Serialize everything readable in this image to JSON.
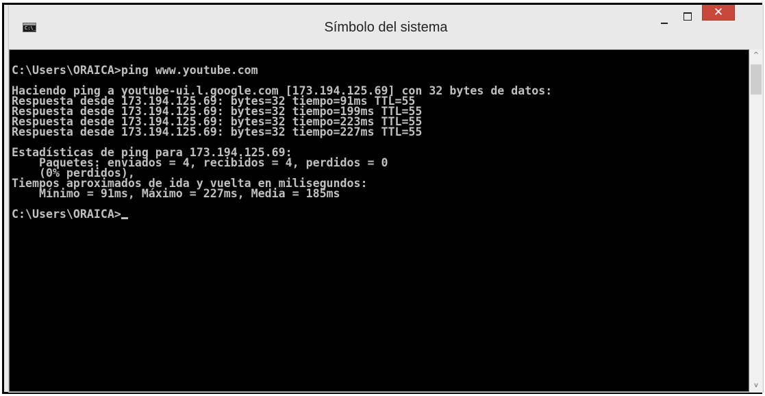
{
  "window": {
    "title": "Símbolo del sistema",
    "icon": "cmd-icon",
    "icon_text": "C:\\_",
    "controls": {
      "minimize_icon": "minimize-icon",
      "maximize_icon": "maximize-icon",
      "close_icon": "close-icon",
      "close_glyph": "✕",
      "close_color": "#c9483c"
    }
  },
  "console": {
    "background": "#000000",
    "foreground": "#c0c0c0",
    "lines": [
      "C:\\Users\\ORAICA>ping www.youtube.com",
      "",
      "Haciendo ping a youtube-ui.l.google.com [173.194.125.69] con 32 bytes de datos:",
      "Respuesta desde 173.194.125.69: bytes=32 tiempo=91ms TTL=55",
      "Respuesta desde 173.194.125.69: bytes=32 tiempo=199ms TTL=55",
      "Respuesta desde 173.194.125.69: bytes=32 tiempo=223ms TTL=55",
      "Respuesta desde 173.194.125.69: bytes=32 tiempo=227ms TTL=55",
      "",
      "Estadísticas de ping para 173.194.125.69:",
      "    Paquetes: enviados = 4, recibidos = 4, perdidos = 0",
      "    (0% perdidos),",
      "Tiempos aproximados de ida y vuelta en milisegundos:",
      "    Mínimo = 91ms, Máximo = 227ms, Media = 185ms",
      ""
    ],
    "prompt": "C:\\Users\\ORAICA>"
  },
  "scrollbar": {
    "up_glyph": "^",
    "down_glyph": "v"
  }
}
